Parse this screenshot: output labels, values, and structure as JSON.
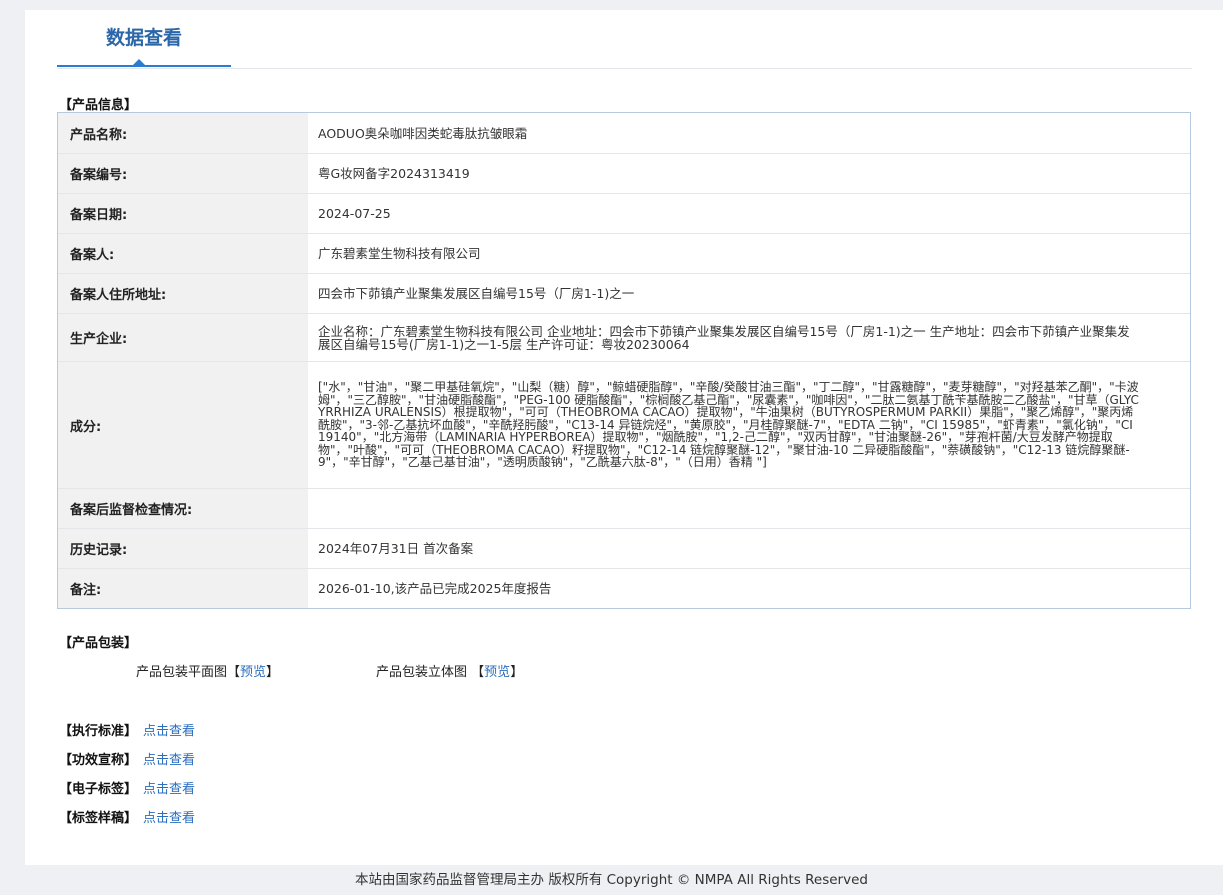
{
  "page": {
    "tab_title": "数据查看"
  },
  "product_info": {
    "section_title": "【产品信息】",
    "rows": [
      {
        "label": "产品名称:",
        "value": "AODUO奥朵咖啡因类蛇毒肽抗皱眼霜"
      },
      {
        "label": "备案编号:",
        "value": "粤G妆网备字2024313419"
      },
      {
        "label": "备案日期:",
        "value": "2024-07-25"
      },
      {
        "label": "备案人:",
        "value": "广东碧素堂生物科技有限公司"
      },
      {
        "label": "备案人住所地址:",
        "value": "四会市下茆镇产业聚集发展区自编号15号（厂房1-1)之一"
      },
      {
        "label": "生产企业:",
        "value": "企业名称：广东碧素堂生物科技有限公司 企业地址：四会市下茆镇产业聚集发展区自编号15号（厂房1-1)之一 生产地址：四会市下茆镇产业聚集发展区自编号15号(厂房1-1)之一1-5层 生产许可证：粤妆20230064"
      },
      {
        "label": "成分:",
        "value": "[\"水\"，\"甘油\"，\"聚二甲基硅氧烷\"，\"山梨（糖）醇\"，\"鲸蜡硬脂醇\"，\"辛酸/癸酸甘油三酯\"，\"丁二醇\"，\"甘露糖醇\"，\"麦芽糖醇\"，\"对羟基苯乙酮\"，\"卡波姆\"，\"三乙醇胺\"，\"甘油硬脂酸酯\"，\"PEG-100 硬脂酸酯\"，\"棕榈酸乙基己酯\"，\"尿囊素\"，\"咖啡因\"，\"二肽二氨基丁酰苄基酰胺二乙酸盐\"，\"甘草（GLYCYRRHIZA URALENSIS）根提取物\"，\"可可（THEOBROMA CACAO）提取物\"，\"牛油果树（BUTYROSPERMUM PARKII）果脂\"，\"聚乙烯醇\"，\"聚丙烯酰胺\"，\"3-邻-乙基抗坏血酸\"，\"辛酰羟肟酸\"，\"C13-14 异链烷烃\"，\"黄原胶\"，\"月桂醇聚醚-7\"，\"EDTA 二钠\"，\"CI 15985\"，\"虾青素\"，\"氯化钠\"，\"CI 19140\"，\"北方海带（LAMINARIA HYPERBOREA）提取物\"，\"烟酰胺\"，\"1,2-己二醇\"，\"双丙甘醇\"，\"甘油聚醚-26\"，\"芽孢杆菌/大豆发酵产物提取物\"，\"叶酸\"，\"可可（THEOBROMA CACAO）籽提取物\"，\"C12-14 链烷醇聚醚-12\"，\"聚甘油-10 二异硬脂酸酯\"，\"萘磺酸钠\"，\"C12-13 链烷醇聚醚-9\"，\"辛甘醇\"，\"乙基己基甘油\"，\"透明质酸钠\"，\"乙酰基六肽-8\"，\"（日用）香精 \"]"
      },
      {
        "label": "备案后监督检查情况:",
        "value": ""
      },
      {
        "label": "历史记录:",
        "value": "2024年07月31日 首次备案"
      },
      {
        "label": "备注:",
        "value": "2026-01-10,该产品已完成2025年度报告"
      }
    ]
  },
  "packaging": {
    "section_title": "【产品包装】",
    "flat_label": "产品包装平面图",
    "stereo_label": "产品包装立体图",
    "bracket_open": "【",
    "bracket_close": "】",
    "preview_label": "预览"
  },
  "standards": [
    {
      "label": "【执行标准】",
      "link": "点击查看"
    },
    {
      "label": "【功效宣称】",
      "link": "点击查看"
    },
    {
      "label": "【电子标签】",
      "link": "点击查看"
    },
    {
      "label": "【标签样稿】",
      "link": "点击查看"
    }
  ],
  "footer": {
    "text": "本站由国家药品监督管理局主办 版权所有 Copyright © NMPA All Rights Reserved"
  },
  "colors": {
    "accent": "#2b7bd0",
    "title": "#2b66a8",
    "link": "#2a6ebd",
    "table_border": "#b6c9de",
    "label_bg": "#f1f1f1",
    "page_bg": "#eef0f3"
  }
}
